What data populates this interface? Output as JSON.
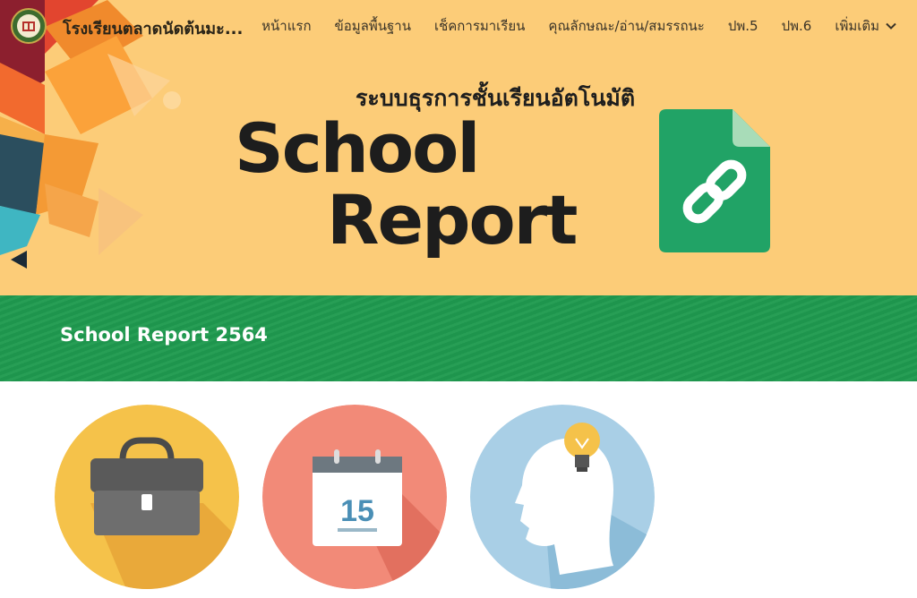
{
  "header": {
    "site_title": "โรงเรียนตลาดนัดต้นมะ...",
    "nav": [
      {
        "label": "หน้าแรก"
      },
      {
        "label": "ข้อมูลพื้นฐาน"
      },
      {
        "label": "เช็คการมาเรียน"
      },
      {
        "label": "คุณลักษณะ/อ่าน/สมรรถนะ"
      },
      {
        "label": "ปพ.5"
      },
      {
        "label": "ปพ.6"
      }
    ],
    "more_label": "เพิ่มเติม"
  },
  "hero": {
    "subtitle": "ระบบธุรการชั้นเรียนอัตโนมัติ",
    "title_line1": "School",
    "title_line2": "Report",
    "icon": "link-document-icon"
  },
  "banner": {
    "title": "School Report 2564"
  },
  "cards": [
    {
      "icon": "briefcase-icon",
      "color": "#f5c24a"
    },
    {
      "icon": "calendar-icon",
      "calendar_day": "15",
      "color": "#f28a78"
    },
    {
      "icon": "idea-head-icon",
      "color": "#a9cfe6"
    }
  ],
  "colors": {
    "hero_bg": "#fccc78",
    "banner_bg": "#1f9a4f",
    "doc_green": "#21a366"
  }
}
